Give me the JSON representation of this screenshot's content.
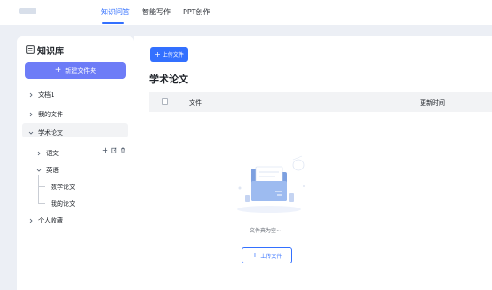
{
  "header": {
    "tabs": [
      {
        "label": "知识问答",
        "active": true
      },
      {
        "label": "智能写作",
        "active": false
      },
      {
        "label": "PPT创作",
        "active": false
      }
    ],
    "accent_color": "#3370ff"
  },
  "sidebar": {
    "title": "知识库",
    "title_icon": "book-icon",
    "new_folder_label": "新建文件夹",
    "items": [
      {
        "label": "文档1",
        "expanded": false
      },
      {
        "label": "我的文件",
        "expanded": false
      },
      {
        "label": "学术论文",
        "expanded": true,
        "selected": true
      },
      {
        "label": "语文",
        "expanded": false,
        "actions": [
          "add-icon",
          "edit-icon",
          "delete-icon"
        ]
      },
      {
        "label": "英语",
        "expanded": true
      },
      {
        "label": "数学论文"
      },
      {
        "label": "我的论文"
      },
      {
        "label": "个人收藏",
        "expanded": false
      }
    ]
  },
  "main": {
    "upload_label": "上传文件",
    "title": "学术论文",
    "table": {
      "columns": [
        "文件",
        "更新时间"
      ]
    },
    "empty": {
      "text": "文件夹为空~",
      "upload_label": "上传文件"
    }
  }
}
